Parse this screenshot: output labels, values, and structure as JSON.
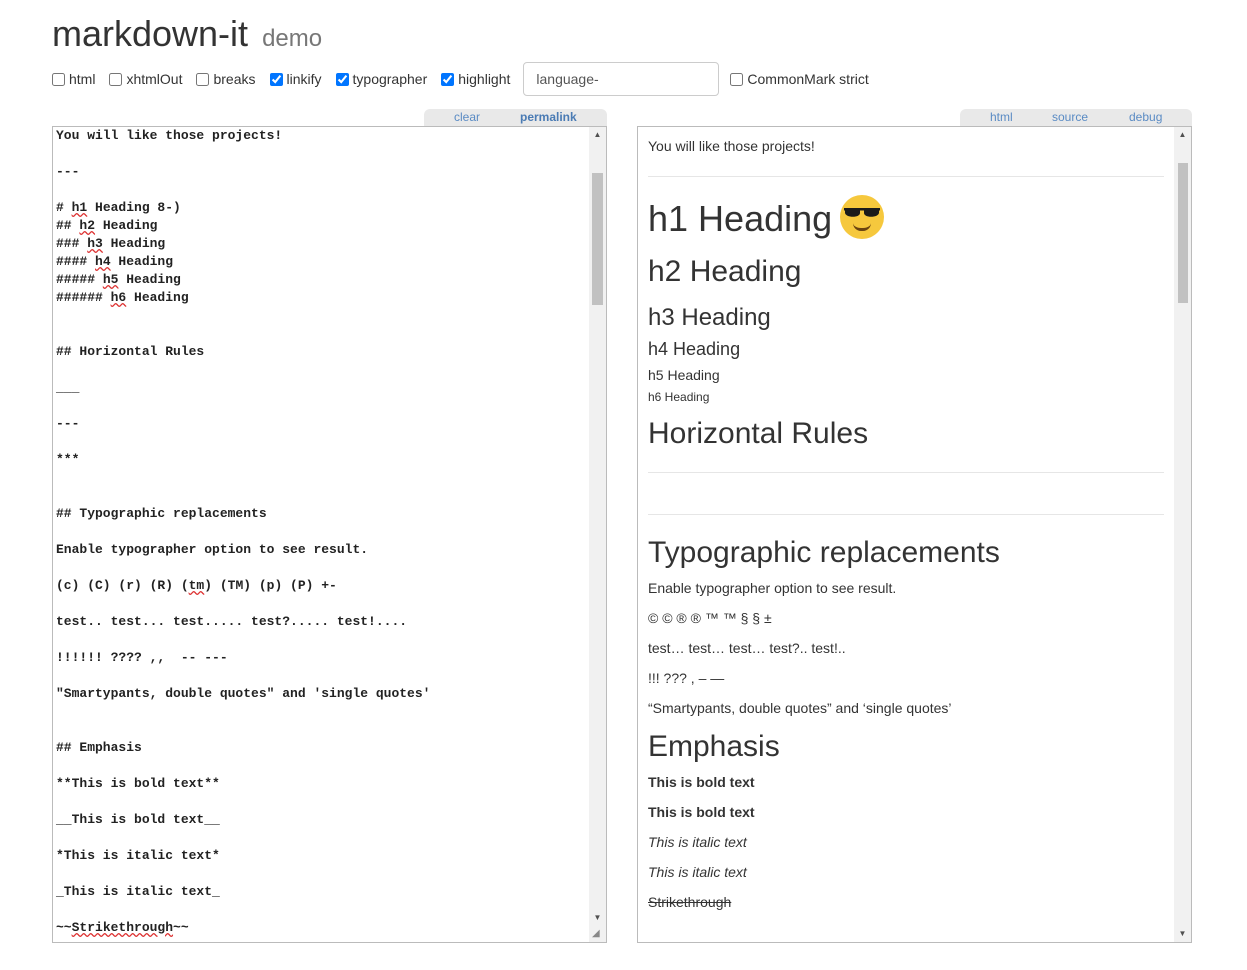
{
  "header": {
    "title": "markdown-it",
    "subtitle": "demo"
  },
  "options": {
    "html": {
      "label": "html",
      "checked": false
    },
    "xhtmlOut": {
      "label": "xhtmlOut",
      "checked": false
    },
    "breaks": {
      "label": "breaks",
      "checked": false
    },
    "linkify": {
      "label": "linkify",
      "checked": true
    },
    "typographer": {
      "label": "typographer",
      "checked": true
    },
    "highlight": {
      "label": "highlight",
      "checked": true
    },
    "lang_prefix": {
      "value": "language-"
    },
    "commonmark": {
      "label": "CommonMark strict",
      "checked": false
    }
  },
  "source_tabs": {
    "clear": "clear",
    "permalink": "permalink"
  },
  "result_tabs": {
    "html": "html",
    "source": "source",
    "debug": "debug"
  },
  "editor_lines": [
    "You will like those projects!",
    "",
    "---",
    "",
    "# h1 Heading 8-)",
    "## h2 Heading",
    "### h3 Heading",
    "#### h4 Heading",
    "##### h5 Heading",
    "###### h6 Heading",
    "",
    "",
    "## Horizontal Rules",
    "",
    "___",
    "",
    "---",
    "",
    "***",
    "",
    "",
    "## Typographic replacements",
    "",
    "Enable typographer option to see result.",
    "",
    "(c) (C) (r) (R) (tm) (TM) (p) (P) +-",
    "",
    "test.. test... test..... test?..... test!....",
    "",
    "!!!!!! ???? ,,  -- ---",
    "",
    "\"Smartypants, double quotes\" and 'single quotes'",
    "",
    "",
    "## Emphasis",
    "",
    "**This is bold text**",
    "",
    "__This is bold text__",
    "",
    "*This is italic text*",
    "",
    "_This is italic text_",
    "",
    "~~Strikethrough~~"
  ],
  "preview": {
    "intro": "You will like those projects!",
    "h1": "h1 Heading",
    "h2": "h2 Heading",
    "h3": "h3 Heading",
    "h4": "h4 Heading",
    "h5": "h5 Heading",
    "h6": "h6 Heading",
    "hr_heading": "Horizontal Rules",
    "typo_heading": "Typographic replacements",
    "typo_intro": "Enable typographer option to see result.",
    "typo_symbols": "© © ® ® ™ ™ § § ±",
    "typo_dots": "test… test… test… test?.. test!..",
    "typo_punct": "!!! ??? , – —",
    "typo_quotes": "“Smartypants, double quotes” and ‘single quotes’",
    "emph_heading": "Emphasis",
    "bold1": "This is bold text",
    "bold2": "This is bold text",
    "italic1": "This is italic text",
    "italic2": "This is italic text",
    "strike": "Strikethrough"
  },
  "editor_scroll_fraction": 0.0,
  "preview_scroll_fraction": 0.0
}
